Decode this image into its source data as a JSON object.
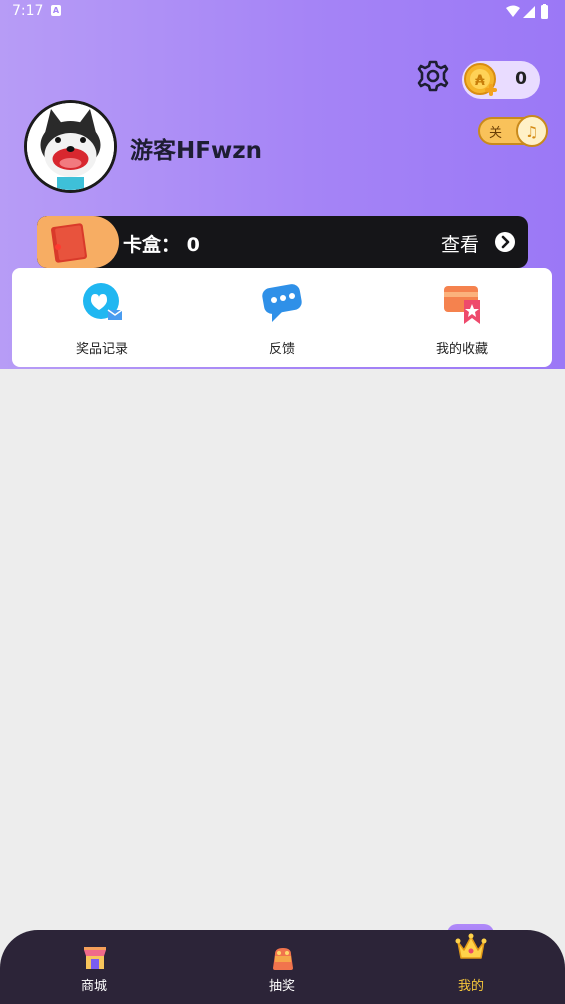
{
  "status_bar": {
    "time": "7:17"
  },
  "profile": {
    "username": "游客HFwzn",
    "coins": "0"
  },
  "card_box": {
    "label": "卡盒：",
    "count": "0",
    "view_label": "查看"
  },
  "menu": [
    {
      "label": "奖品记录",
      "icon": "chat-heart-icon"
    },
    {
      "label": "反馈",
      "icon": "feedback-bubble-icon"
    },
    {
      "label": "我的收藏",
      "icon": "bookmark-star-icon"
    }
  ],
  "bottom_nav": [
    {
      "label": "商城",
      "icon": "shop-icon",
      "active": false
    },
    {
      "label": "抽奖",
      "icon": "lottery-bag-icon",
      "active": false
    },
    {
      "label": "我的",
      "icon": "crown-icon",
      "active": true
    }
  ],
  "colors": {
    "header_gradient_start": "#b79cf6",
    "header_gradient_end": "#9b78f6",
    "active_nav_label": "#f6c73b",
    "nav_background": "#2c2438",
    "card_box_background": "#151518",
    "card_box_accent": "#f7ad63"
  }
}
